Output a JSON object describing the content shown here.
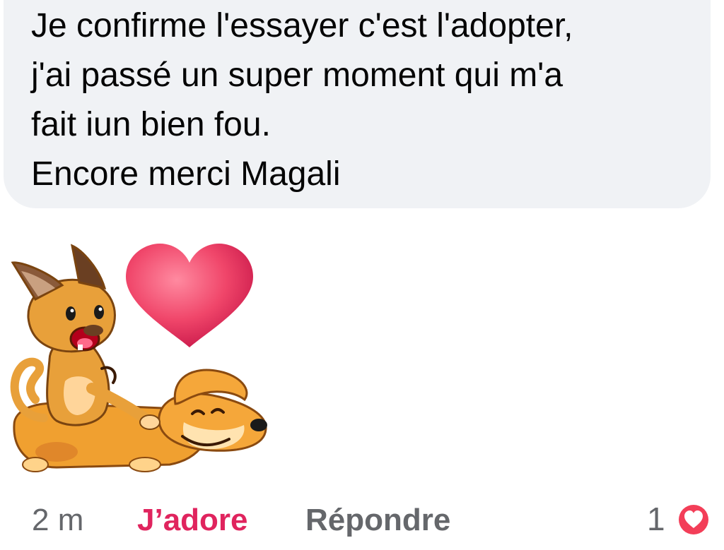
{
  "comment": {
    "lines": [
      "Je confirme l'essayer c'est l'adopter,",
      "j'ai passé un super moment qui m'a",
      "fait iun bien fou.",
      "Encore merci Magali"
    ]
  },
  "sticker": {
    "icon": "cat-and-dog-love-sticker"
  },
  "footer": {
    "time": "2 m",
    "react_label": "J’adore",
    "reply_label": "Répondre",
    "reaction_count": "1",
    "reaction_icon": "heart-reaction-icon"
  },
  "colors": {
    "bubble_bg": "#f0f2f5",
    "react_accent": "#e0245e",
    "muted_text": "#65676b",
    "heart_badge": "#f33e58"
  }
}
